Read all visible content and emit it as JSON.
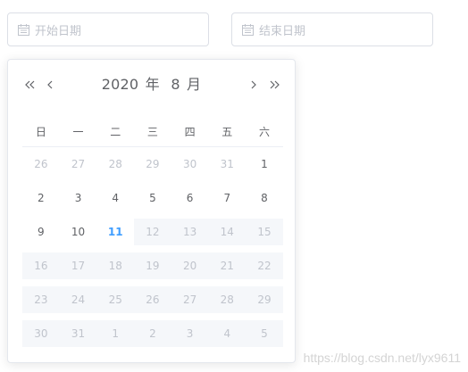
{
  "start_input": {
    "placeholder": "开始日期"
  },
  "end_input": {
    "placeholder": "结束日期"
  },
  "calendar": {
    "year": "2020",
    "year_suffix": "年",
    "month": "8",
    "month_suffix": "月",
    "weekdays": [
      "日",
      "一",
      "二",
      "三",
      "四",
      "五",
      "六"
    ],
    "weeks": [
      [
        {
          "d": "26",
          "t": "prev"
        },
        {
          "d": "27",
          "t": "prev"
        },
        {
          "d": "28",
          "t": "prev"
        },
        {
          "d": "29",
          "t": "prev"
        },
        {
          "d": "30",
          "t": "prev"
        },
        {
          "d": "31",
          "t": "prev"
        },
        {
          "d": "1",
          "t": "normal"
        }
      ],
      [
        {
          "d": "2",
          "t": "normal"
        },
        {
          "d": "3",
          "t": "normal"
        },
        {
          "d": "4",
          "t": "normal"
        },
        {
          "d": "5",
          "t": "normal"
        },
        {
          "d": "6",
          "t": "normal"
        },
        {
          "d": "7",
          "t": "normal"
        },
        {
          "d": "8",
          "t": "normal"
        }
      ],
      [
        {
          "d": "9",
          "t": "normal"
        },
        {
          "d": "10",
          "t": "normal"
        },
        {
          "d": "11",
          "t": "today"
        },
        {
          "d": "12",
          "t": "disabled"
        },
        {
          "d": "13",
          "t": "disabled"
        },
        {
          "d": "14",
          "t": "disabled"
        },
        {
          "d": "15",
          "t": "disabled"
        }
      ],
      [
        {
          "d": "16",
          "t": "disabled"
        },
        {
          "d": "17",
          "t": "disabled"
        },
        {
          "d": "18",
          "t": "disabled"
        },
        {
          "d": "19",
          "t": "disabled"
        },
        {
          "d": "20",
          "t": "disabled"
        },
        {
          "d": "21",
          "t": "disabled"
        },
        {
          "d": "22",
          "t": "disabled"
        }
      ],
      [
        {
          "d": "23",
          "t": "disabled"
        },
        {
          "d": "24",
          "t": "disabled"
        },
        {
          "d": "25",
          "t": "disabled"
        },
        {
          "d": "26",
          "t": "disabled"
        },
        {
          "d": "27",
          "t": "disabled"
        },
        {
          "d": "28",
          "t": "disabled"
        },
        {
          "d": "29",
          "t": "disabled"
        }
      ],
      [
        {
          "d": "30",
          "t": "disabled"
        },
        {
          "d": "31",
          "t": "disabled"
        },
        {
          "d": "1",
          "t": "disabled"
        },
        {
          "d": "2",
          "t": "disabled"
        },
        {
          "d": "3",
          "t": "disabled"
        },
        {
          "d": "4",
          "t": "disabled"
        },
        {
          "d": "5",
          "t": "disabled"
        }
      ]
    ]
  },
  "icons": {
    "calendar": "calendar-icon",
    "prev_year": "double-chevron-left-icon",
    "prev_month": "chevron-left-icon",
    "next_month": "chevron-right-icon",
    "next_year": "double-chevron-right-icon"
  },
  "colors": {
    "today": "#409eff",
    "disabled_bg": "#f5f7fa",
    "muted_text": "#c0c4cc",
    "text": "#606266",
    "border": "#dcdfe6"
  },
  "watermark": "https://blog.csdn.net/lyx9611"
}
